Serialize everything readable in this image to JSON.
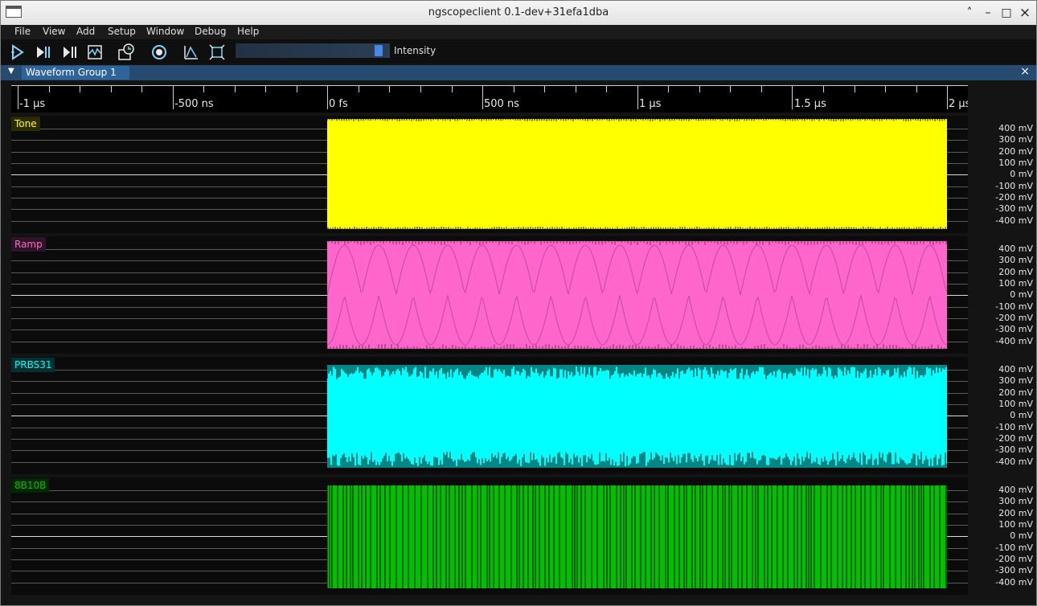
{
  "window": {
    "title": "ngscopeclient 0.1-dev+31efa1dba",
    "controls": [
      "˄",
      "–",
      "□",
      "×"
    ]
  },
  "menu": [
    "File",
    "View",
    "Add",
    "Setup",
    "Window",
    "Debug",
    "Help"
  ],
  "toolbar": {
    "icons": [
      "start-trigger-icon",
      "single-trigger-icon",
      "force-trigger-icon",
      "stop-trigger-icon",
      "history-icon",
      "refresh-icon",
      "measure-icon",
      "fullscreen-icon"
    ],
    "intensity_label": "Intensity",
    "intensity_level": 0.95
  },
  "group": {
    "collapse": "▼",
    "title": "Waveform Group 1",
    "close": "×"
  },
  "timeline": {
    "labels": [
      "-1 µs",
      "-500 ns",
      "0 fs",
      "500 ns",
      "1 µs",
      "1.5 µs",
      "2 µs"
    ]
  },
  "y_axis_labels": [
    "400 mV",
    "300 mV",
    "200 mV",
    "100 mV",
    "0 mV",
    "-100 mV",
    "-200 mV",
    "-300 mV",
    "-400 mV"
  ],
  "channels": [
    {
      "name": "Tone",
      "color": "#ffff00",
      "label_bg": "#2b2b00"
    },
    {
      "name": "Ramp",
      "color": "#ff66cc",
      "label_bg": "#2d1526"
    },
    {
      "name": "PRBS31",
      "color": "#00ffff",
      "label_bg": "#003030"
    },
    {
      "name": "8B10B",
      "color": "#00c000",
      "label_bg": "#002800"
    }
  ]
}
